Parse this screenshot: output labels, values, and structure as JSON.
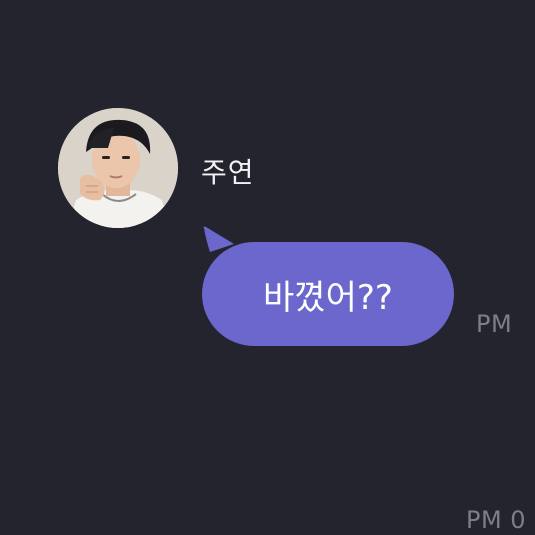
{
  "conversation": {
    "background": "#24242e",
    "bubble_color": "#6b67cc",
    "messages": [
      {
        "sender": "주연",
        "avatar": "profile-photo",
        "text": "바꼈어??",
        "time": "PM"
      }
    ],
    "next_time": "PM 0"
  }
}
